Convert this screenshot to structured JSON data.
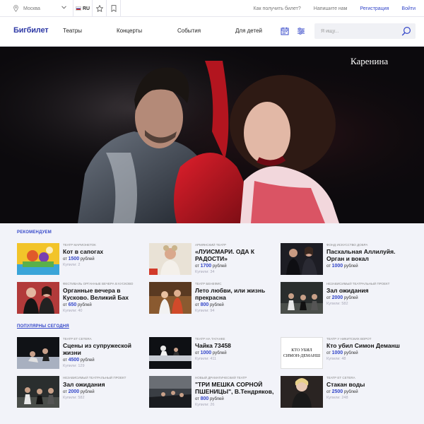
{
  "topbar": {
    "city": "Москва",
    "lang": "RU",
    "links": [
      "Как получить билет?",
      "Напишите нам",
      "Регистрация",
      "Войти"
    ]
  },
  "header": {
    "logo": "Бигбилет",
    "nav": [
      "Театры",
      "Концерты",
      "События",
      "Для детей"
    ],
    "search_placeholder": "Я ищу..."
  },
  "hero": {
    "title": "Каренина"
  },
  "sections": [
    {
      "title": "РЕКОМЕНДУЕМ",
      "cards": [
        {
          "venue": "ТЕАТР МАРИОНЕТОК",
          "title": "Кот в сапогах",
          "price_prefix": "от",
          "price": "1500",
          "price_suffix": "рублей",
          "bought": "Купили: 2"
        },
        {
          "venue": "АРМЯНСКИЙ ТЕАТР",
          "title": "«ЛУИСМАРИ. ОДА К РАДОСТИ»",
          "price_prefix": "от",
          "price": "1700",
          "price_suffix": "рублей",
          "bought": "Купили: 34"
        },
        {
          "venue": "ФОНД ИСКУССТВО ДОБРА",
          "title": "Пасхальная Аллилуйя. Орган и вокал",
          "price_prefix": "от",
          "price": "1000",
          "price_suffix": "рублей",
          "bought": ""
        },
        {
          "venue": "ФЕСТИВАЛЬ ОРГАННЫЕ ВЕЧЕРА В КУСКОВО",
          "title": "Органные вечера в Кусково. Великий Бах",
          "price_prefix": "от",
          "price": "650",
          "price_suffix": "рублей",
          "bought": "Купили: 40"
        },
        {
          "venue": "ТЕАТР БЕНЕФИС",
          "title": "Лето любви, или жизнь прекрасна",
          "price_prefix": "от",
          "price": "800",
          "price_suffix": "рублей",
          "bought": "Купили: 94"
        },
        {
          "venue": "НЕЗАВИСИМЫЙ ТЕАТРАЛЬНЫЙ ПРОЕКТ",
          "title": "Зал ожидания",
          "price_prefix": "от",
          "price": "2000",
          "price_suffix": "рублей",
          "bought": "Купили: 582"
        }
      ]
    },
    {
      "title": "ПОПУЛЯРНЫ СЕГОДНЯ",
      "cards": [
        {
          "venue": "ТЕАТР ET CETERA",
          "title": "Сцены из супружеской жизни",
          "price_prefix": "от",
          "price": "4500",
          "price_suffix": "рублей",
          "bought": "Купили: 129"
        },
        {
          "venue": "ТЕАТР НА ТАГАНКЕ",
          "title": "Чайка 73458",
          "price_prefix": "от",
          "price": "1000",
          "price_suffix": "рублей",
          "bought": "Купили: 411"
        },
        {
          "venue": "ТЕАТР У НИКИТСКИХ ВОРОТ",
          "title": "Кто убил Симон Деманш",
          "price_prefix": "от",
          "price": "1000",
          "price_suffix": "рублей",
          "bought": "Купили: 48"
        },
        {
          "venue": "НЕЗАВИСИМЫЙ ТЕАТРАЛЬНЫЙ ПРОЕКТ",
          "title": "Зал ожидания",
          "price_prefix": "от",
          "price": "2000",
          "price_suffix": "рублей",
          "bought": "Купили: 582"
        },
        {
          "venue": "НОВЫЙ ДРАМАТИЧЕСКИЙ ТЕАТР",
          "title": "\"ТРИ МЕШКА СОРНОЙ ПШЕНИЦЫ\", В.Тендряков,",
          "price_prefix": "от",
          "price": "800",
          "price_suffix": "рублей",
          "bought": "Купили: 26"
        },
        {
          "venue": "ТЕАТР ET CETERA",
          "title": "Стакан воды",
          "price_prefix": "от",
          "price": "2500",
          "price_suffix": "рублей",
          "bought": "Купили: 248"
        }
      ]
    }
  ],
  "thumb_texts": {
    "kto_ubil": [
      "КТО УБИЛ",
      "СИМОН-ДЕМАНШ"
    ]
  },
  "colors": {
    "accent": "#3447c9",
    "page_bg": "#f2f3f9"
  }
}
